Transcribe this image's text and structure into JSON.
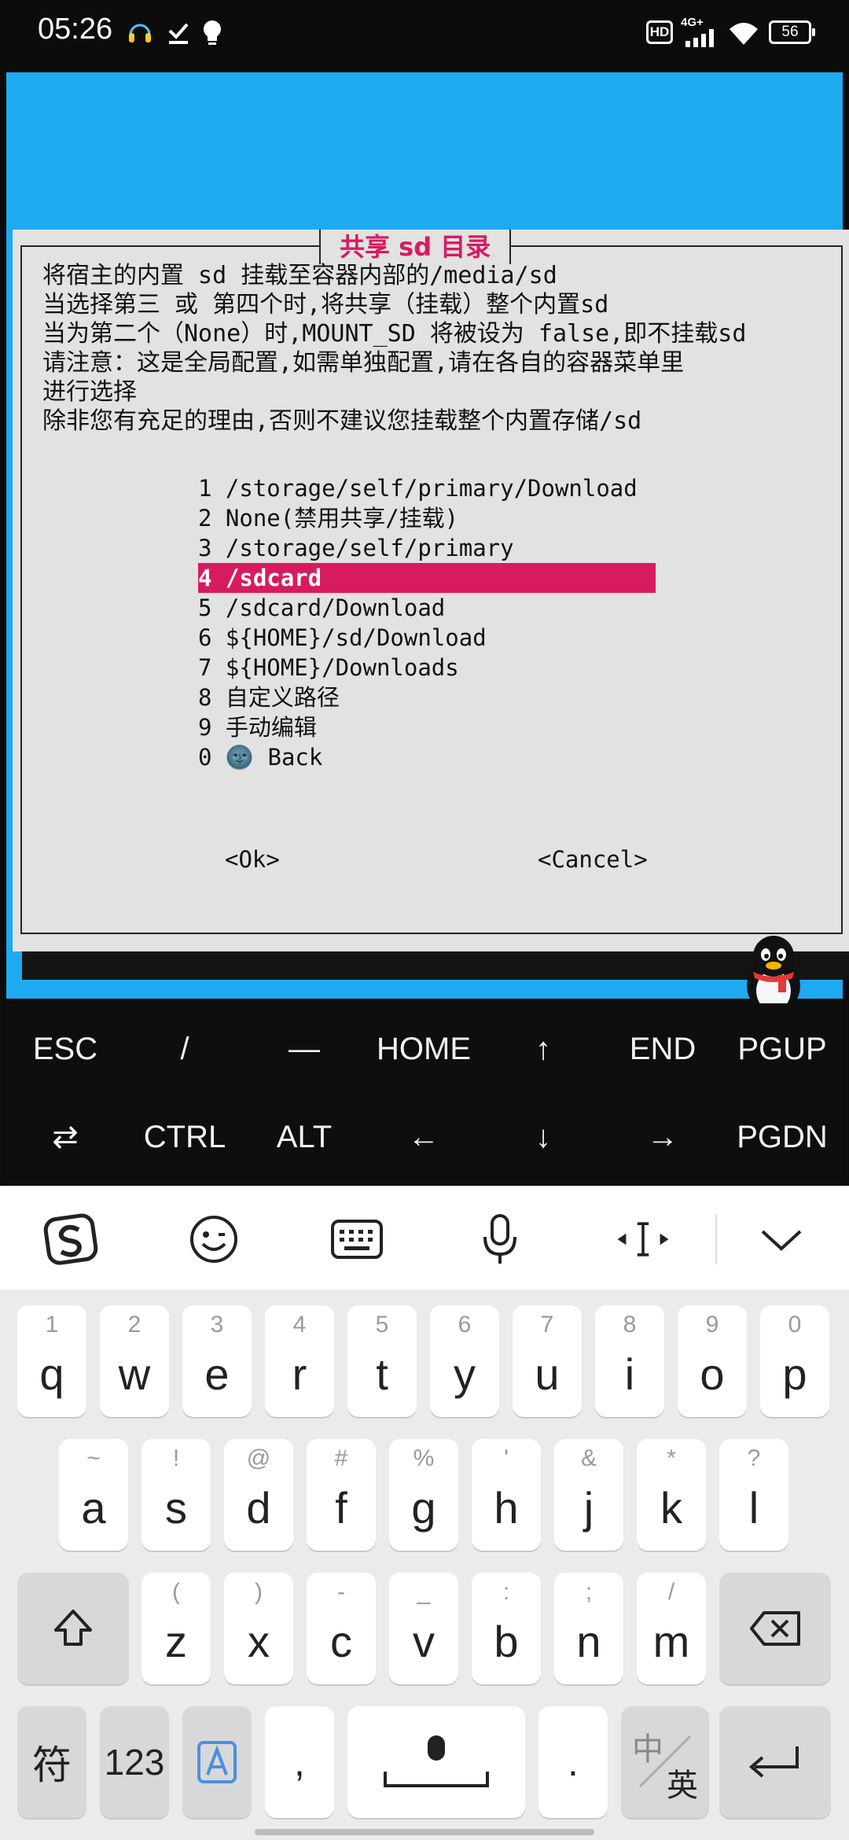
{
  "status_bar": {
    "time": "05:26",
    "hd_label": "HD",
    "signal_label": "4G+",
    "battery": "56",
    "left_icons": [
      "headset-icon",
      "download-check-icon",
      "bulb-icon"
    ],
    "right_icons": [
      "hd-icon",
      "signal-icon",
      "wifi-icon",
      "battery-icon"
    ]
  },
  "dialog": {
    "title": "共享 sd 目录",
    "description": "将宿主的内置 sd 挂载至容器内部的/media/sd\n当选择第三 或 第四个时,将共享（挂载）整个内置sd\n当为第二个（None）时,MOUNT_SD 将被设为 false,即不挂载sd\n请注意：这是全局配置,如需单独配置,请在各自的容器菜单里\n进行选择\n除非您有充足的理由,否则不建议您挂载整个内置存储/sd",
    "menu": [
      {
        "label": "1 /storage/self/primary/Download"
      },
      {
        "label": "2 None(禁用共享/挂载)"
      },
      {
        "label": "3 /storage/self/primary"
      },
      {
        "label": "4 /sdcard"
      },
      {
        "label": "5 /sdcard/Download"
      },
      {
        "label": "6 ${HOME}/sd/Download"
      },
      {
        "label": "7 ${HOME}/Downloads"
      },
      {
        "label": "8 自定义路径"
      },
      {
        "label": "9 手动编辑"
      },
      {
        "label": "0 🌚 Back"
      }
    ],
    "selected_index": 3,
    "ok_label": "<Ok>",
    "cancel_label": "<Cancel>"
  },
  "extra_keys": {
    "row1": [
      "ESC",
      "/",
      "—",
      "HOME",
      "↑",
      "END",
      "PGUP"
    ],
    "row2": [
      "⇄",
      "CTRL",
      "ALT",
      "←",
      "↓",
      "→",
      "PGDN"
    ]
  },
  "ime_toolbar": {
    "icons": [
      "sogou-logo-icon",
      "emoji-icon",
      "keyboard-icon",
      "microphone-icon",
      "cursor-move-icon",
      "collapse-chevron-icon"
    ]
  },
  "keyboard": {
    "row1": [
      {
        "main": "q",
        "sub": "1"
      },
      {
        "main": "w",
        "sub": "2"
      },
      {
        "main": "e",
        "sub": "3"
      },
      {
        "main": "r",
        "sub": "4"
      },
      {
        "main": "t",
        "sub": "5"
      },
      {
        "main": "y",
        "sub": "6"
      },
      {
        "main": "u",
        "sub": "7"
      },
      {
        "main": "i",
        "sub": "8"
      },
      {
        "main": "o",
        "sub": "9"
      },
      {
        "main": "p",
        "sub": "0"
      }
    ],
    "row2": [
      {
        "main": "a",
        "sub": "~"
      },
      {
        "main": "s",
        "sub": "!"
      },
      {
        "main": "d",
        "sub": "@"
      },
      {
        "main": "f",
        "sub": "#"
      },
      {
        "main": "g",
        "sub": "%"
      },
      {
        "main": "h",
        "sub": "'"
      },
      {
        "main": "j",
        "sub": "&"
      },
      {
        "main": "k",
        "sub": "*"
      },
      {
        "main": "l",
        "sub": "?"
      }
    ],
    "row3": [
      {
        "main": "z",
        "sub": "("
      },
      {
        "main": "x",
        "sub": ")"
      },
      {
        "main": "c",
        "sub": "-"
      },
      {
        "main": "v",
        "sub": "_"
      },
      {
        "main": "b",
        "sub": ":"
      },
      {
        "main": "n",
        "sub": ";"
      },
      {
        "main": "m",
        "sub": "/"
      }
    ],
    "symbols_label": "符",
    "numbers_label": "123",
    "comma_label": ",",
    "period_label": ".",
    "lang_top": "中",
    "lang_bottom": "英"
  }
}
